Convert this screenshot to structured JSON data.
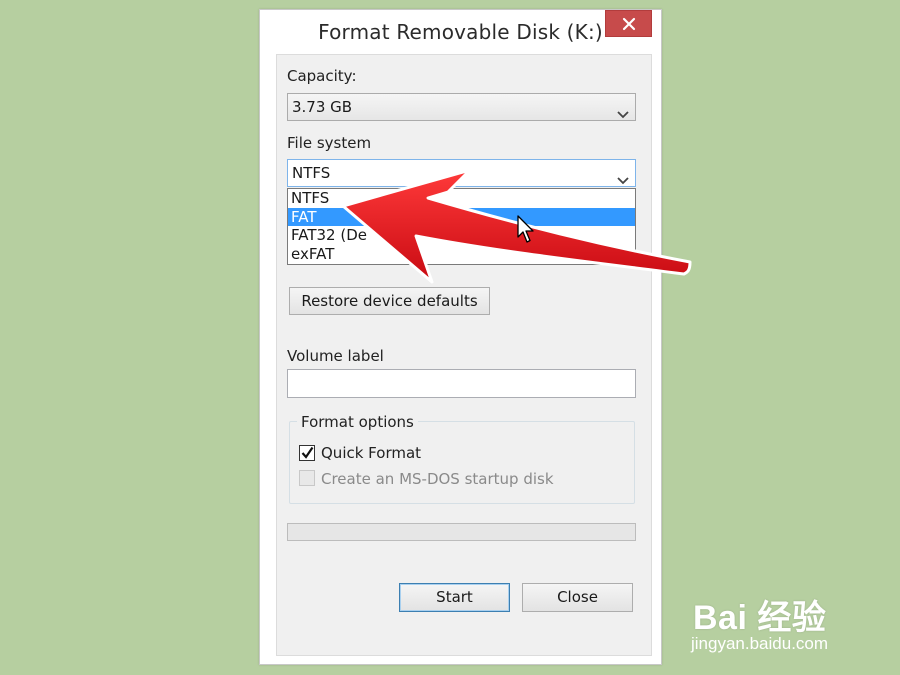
{
  "window": {
    "title": "Format Removable Disk (K:)"
  },
  "capacity": {
    "label": "Capacity:",
    "value": "3.73 GB"
  },
  "file_system": {
    "label": "File system",
    "value": "NTFS",
    "options": [
      {
        "label": "NTFS",
        "selected": false
      },
      {
        "label": "FAT",
        "selected": true
      },
      {
        "label": "FAT32 (De",
        "selected": false
      },
      {
        "label": "exFAT",
        "selected": false
      }
    ]
  },
  "buttons": {
    "restore_defaults": "Restore device defaults",
    "start": "Start",
    "close": "Close"
  },
  "volume_label": {
    "label": "Volume label",
    "value": ""
  },
  "format_options": {
    "legend": "Format options",
    "quick_format": {
      "label": "Quick Format",
      "checked": true
    },
    "ms_dos": {
      "label": "Create an MS-DOS startup disk",
      "checked": false,
      "enabled": false
    }
  },
  "progress": {
    "fraction": 0
  },
  "watermark": {
    "logo": "Bai 经验",
    "url": "jingyan.baidu.com"
  },
  "colors": {
    "background": "#b6cfa0",
    "close_button": "#c74b4b",
    "selection": "#3399ff",
    "annotation_arrow": "#e0101a"
  },
  "icons": {
    "close": "close-icon",
    "chevron": "chevron-down-icon",
    "check": "checkmark-icon",
    "cursor": "mouse-pointer-icon",
    "annotation": "red-arrow-annotation"
  }
}
